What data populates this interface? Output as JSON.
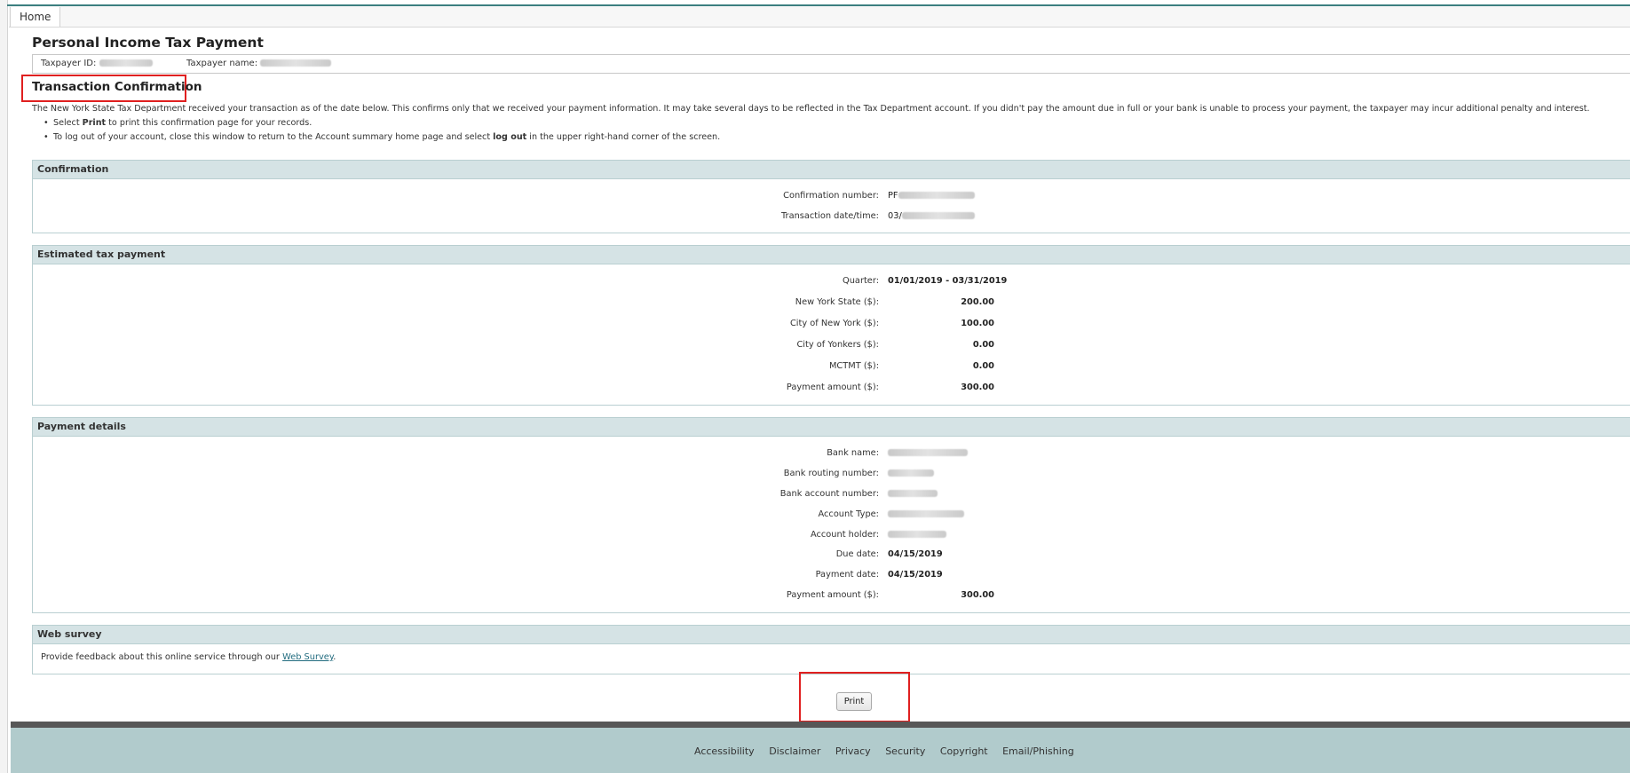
{
  "tabs": {
    "home": "Home"
  },
  "page_title": "Personal Income Tax Payment",
  "taxpayer": {
    "id_label": "Taxpayer ID:",
    "name_label": "Taxpayer name:"
  },
  "transaction": {
    "title": "Transaction Confirmation",
    "intro": "The New York State Tax Department received your transaction as of the date below. This confirms only that we received your payment information. It may take several days to be reflected in the Tax Department account. If you didn't pay the amount due in full or your bank is unable to process your payment, the taxpayer may incur additional penalty and interest.",
    "bullet1": {
      "pre": "Select ",
      "bold": "Print",
      "post": " to print this confirmation page for your records."
    },
    "bullet2": {
      "pre": "To log out of your account, close this window to return to the Account summary home page and select ",
      "bold": "log out",
      "post": " in the upper right-hand corner of the screen."
    }
  },
  "confirmation": {
    "header": "Confirmation",
    "number_label": "Confirmation number:",
    "number_prefix": "PF",
    "datetime_label": "Transaction date/time:",
    "datetime_prefix": "03/"
  },
  "estimated": {
    "header": "Estimated tax payment",
    "quarter_label": "Quarter:",
    "quarter_value": "01/01/2019 - 03/31/2019",
    "nys_label": "New York State ($):",
    "nys_value": "200.00",
    "nyc_label": "City of New York ($):",
    "nyc_value": "100.00",
    "yonkers_label": "City of Yonkers ($):",
    "yonkers_value": "0.00",
    "mctmt_label": "MCTMT ($):",
    "mctmt_value": "0.00",
    "payment_label": "Payment amount ($):",
    "payment_value": "300.00"
  },
  "payment_details": {
    "header": "Payment details",
    "bank_name_label": "Bank name:",
    "routing_label": "Bank routing number:",
    "account_number_label": "Bank account number:",
    "account_type_label": "Account Type:",
    "holder_label": "Account holder:",
    "due_label": "Due date:",
    "due_value": "04/15/2019",
    "paydate_label": "Payment date:",
    "paydate_value": "04/15/2019",
    "amount_label": "Payment amount ($):",
    "amount_value": "300.00"
  },
  "survey": {
    "header": "Web survey",
    "text": "Provide feedback about this online service through our ",
    "link": "Web Survey",
    "end": "."
  },
  "print_label": "Print",
  "footer": {
    "accessibility": "Accessibility",
    "disclaimer": "Disclaimer",
    "privacy": "Privacy",
    "security": "Security",
    "copyright": "Copyright",
    "email": "Email/Phishing"
  }
}
